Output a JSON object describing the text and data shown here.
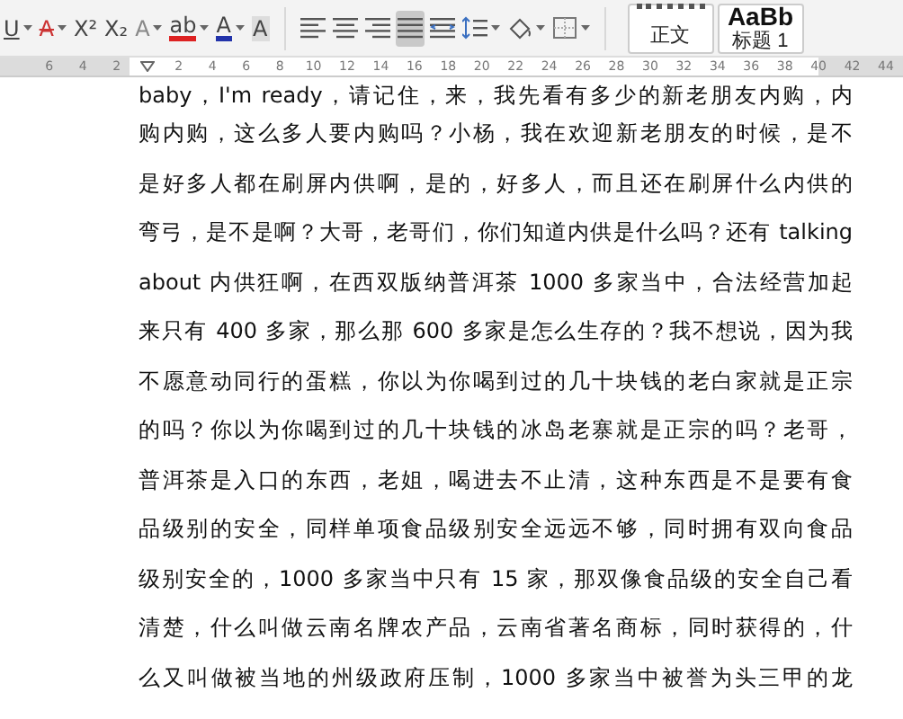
{
  "toolbar": {
    "font_buttons": [
      {
        "glyph": "U",
        "kind": "underline",
        "dropdown": true
      },
      {
        "glyph": "A",
        "kind": "strike",
        "dropdown": true
      },
      {
        "glyph": "X²",
        "kind": "plain",
        "dropdown": false
      },
      {
        "glyph": "X₂",
        "kind": "plain",
        "dropdown": false
      },
      {
        "glyph": "A",
        "kind": "outline",
        "dropdown": true
      },
      {
        "glyph": "ab",
        "kind": "highlight",
        "dropdown": true
      },
      {
        "glyph": "A",
        "kind": "color",
        "dropdown": true
      },
      {
        "glyph": "A",
        "kind": "shaded",
        "dropdown": false
      }
    ],
    "paragraph_buttons": [
      {
        "kind": "align-left",
        "selected": false,
        "dropdown": false
      },
      {
        "kind": "align-center",
        "selected": false,
        "dropdown": false
      },
      {
        "kind": "align-right",
        "selected": false,
        "dropdown": false
      },
      {
        "kind": "justify",
        "selected": true,
        "dropdown": false
      },
      {
        "kind": "distribute",
        "selected": false,
        "dropdown": false
      },
      {
        "kind": "line-spacing",
        "selected": false,
        "dropdown": true
      },
      {
        "kind": "fill",
        "selected": false,
        "dropdown": true
      },
      {
        "kind": "border",
        "selected": false,
        "dropdown": true
      }
    ],
    "styles": [
      {
        "label": "正文",
        "selected": false
      },
      {
        "preview": "AaBb",
        "label": "标题 1",
        "selected": false
      }
    ]
  },
  "ruler": {
    "ticks": [
      "6",
      "4",
      "2",
      "2",
      "4",
      "6",
      "8",
      "10",
      "12",
      "14",
      "16",
      "18",
      "20",
      "22",
      "24",
      "26",
      "28",
      "30",
      "32",
      "34",
      "36",
      "38",
      "40",
      "42",
      "44"
    ]
  },
  "document": {
    "lines": [
      "baby，I'm ready，请记住，来，我先看有多少的新老朋友内购，内",
      "购内购，这么多人要内购吗？小杨，我在欢迎新老朋友的时候，是不",
      "是好多人都在刷屏内供啊，是的，好多人，而且还在刷屏什么内供的",
      "弯弓，是不是啊？大哥，老哥们，你们知道内供是什么吗？还有 talking",
      "about 内供狂啊，在西双版纳普洱茶 1000 多家当中，合法经营加起",
      "来只有 400 多家，那么那 600 多家是怎么生存的？我不想说，因为我",
      "不愿意动同行的蛋糕，你以为你喝到过的几十块钱的老白家就是正宗",
      "的吗？你以为你喝到过的几十块钱的冰岛老寨就是正宗的吗？老哥，",
      "普洱茶是入口的东西，老姐，喝进去不止清，这种东西是不是要有食",
      "品级别的安全，同样单项食品级别安全远远不够，同时拥有双向食品",
      "级别安全的，1000 多家当中只有 15 家，那双像食品级的安全自己看",
      "清楚，什么叫做云南名牌农产品，云南省著名商标，同时获得的，什",
      "么又叫做被当地的州级政府压制，1000 多家当中被誉为头三甲的龙"
    ]
  }
}
